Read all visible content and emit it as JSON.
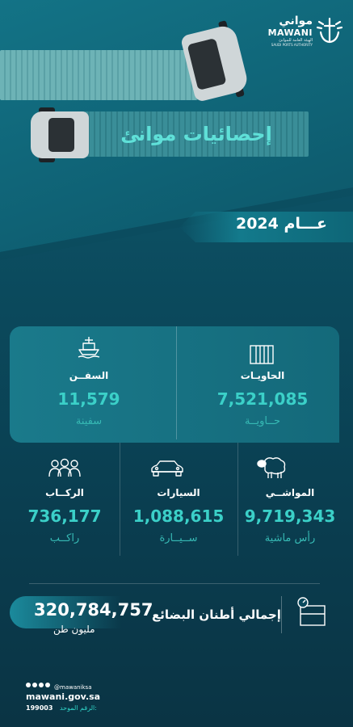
{
  "brand": {
    "logo_ar": "مواني",
    "logo_en": "MAWANI",
    "logo_sub_ar": "الهيئة العامة للموانئ",
    "logo_sub_en": "SAUDI PORTS AUTHORITY"
  },
  "hero": {
    "title": "إحصائيات موانئ"
  },
  "year_label": "عـــام 2024",
  "stats": {
    "containers": {
      "label": "الحاويـات",
      "value": "7,521,085",
      "unit": "حــاويــة"
    },
    "ships": {
      "label": "السفــن",
      "value": "11,579",
      "unit": "سفينة"
    },
    "livestock": {
      "label": "المواشــي",
      "value": "9,719,343",
      "unit": "رأس ماشية"
    },
    "cars": {
      "label": "السيارات",
      "value": "1,088,615",
      "unit": "ســيــارة"
    },
    "passengers": {
      "label": "الركــاب",
      "value": "736,177",
      "unit": "راكــب"
    }
  },
  "total": {
    "label": "إجمالي أطنان البضائع",
    "value": "320,784,757",
    "unit": "مليون طن"
  },
  "footer": {
    "handle": "@mawaniksa",
    "website": "mawani.gov.sa",
    "unified_number_label": "الرقم الموحد:",
    "unified_number": "199003"
  },
  "icons": {
    "logo": "anchor-icon",
    "ships": "ship-icon",
    "containers": "container-icon",
    "passengers": "people-icon",
    "cars": "car-icon",
    "livestock": "sheep-icon",
    "total": "box-scale-icon"
  },
  "colors": {
    "accent": "#3bd0c8",
    "background": "#0b4a5d"
  }
}
